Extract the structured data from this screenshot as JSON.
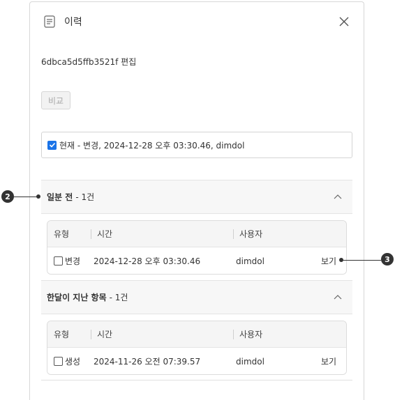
{
  "header": {
    "title": "이력"
  },
  "subtitle": "6dbca5d5ffb3521f  편집",
  "compare_button": "비교",
  "current": {
    "checked": true,
    "text": "현재 - 변경, 2024-12-28 오후 03:30.46, dimdol"
  },
  "table_headers": {
    "type": "유형",
    "time": "시간",
    "user": "사용자"
  },
  "groups": [
    {
      "title": "일분 전",
      "count": "- 1건",
      "rows": [
        {
          "type": "변경",
          "time": "2024-12-28 오후 03:30.46",
          "user": "dimdol",
          "action": "보기"
        }
      ]
    },
    {
      "title": "한달이 지난 항목",
      "count": "- 1건",
      "rows": [
        {
          "type": "생성",
          "time": "2024-11-26 오전 07:39.57",
          "user": "dimdol",
          "action": "보기"
        }
      ]
    }
  ],
  "annotations": [
    "2",
    "3"
  ]
}
